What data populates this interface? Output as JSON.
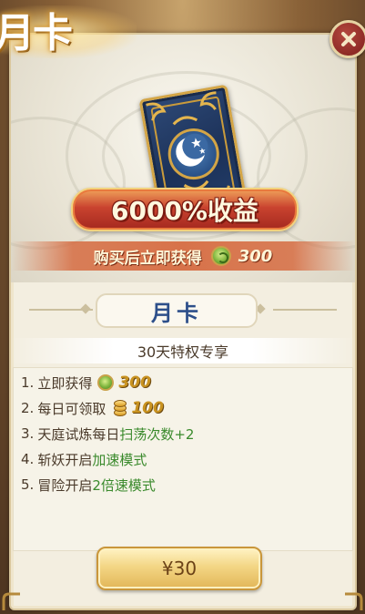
{
  "header": {
    "title_calligraphy": "月卡",
    "close_icon": "close-icon"
  },
  "card": {
    "icon": "moon-card-icon"
  },
  "banner": {
    "text": "6000%收益"
  },
  "buy_strip": {
    "label": "购买后立即获得",
    "currency_icon": "jade-coin-icon",
    "amount": "300"
  },
  "plaque": {
    "title": "月卡"
  },
  "subtitle": "30天特权专享",
  "benefits": [
    {
      "num": "1.",
      "text": "立即获得",
      "icon": "jade-coin-icon",
      "amount": "300",
      "highlight": ""
    },
    {
      "num": "2.",
      "text": "每日可领取",
      "icon": "gold-ingot-icon",
      "amount": "100",
      "highlight": ""
    },
    {
      "num": "3.",
      "text": "天庭试炼每日",
      "icon": "",
      "amount": "",
      "highlight": "扫荡次数+2"
    },
    {
      "num": "4.",
      "text": "斩妖开启",
      "icon": "",
      "amount": "",
      "highlight": "加速模式"
    },
    {
      "num": "5.",
      "text": "冒险开启",
      "icon": "",
      "amount": "",
      "highlight": "2倍速模式"
    }
  ],
  "purchase": {
    "price_label": "¥30"
  },
  "colors": {
    "panel_bg": "#f3eee0",
    "banner_red": "#c9432f",
    "highlight_green": "#3a8a2c",
    "plaque_blue": "#2d4f8a",
    "gold": "#c99320"
  }
}
